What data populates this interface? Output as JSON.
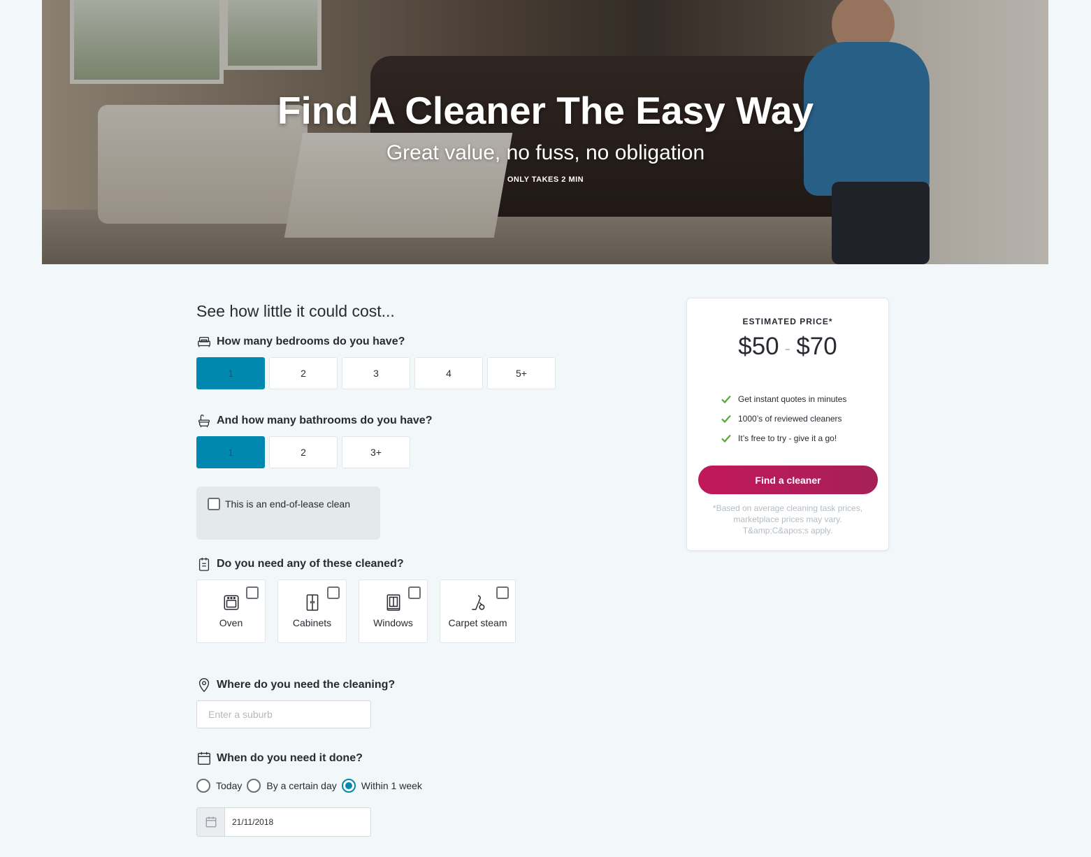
{
  "hero": {
    "title": "Find A Cleaner The Easy Way",
    "subtitle": "Great value, no fuss, no obligation",
    "small": "ONLY TAKES 2 MIN"
  },
  "form": {
    "heading": "See how little it could cost...",
    "bedrooms": {
      "label": "How many bedrooms do you have?",
      "options": [
        "1",
        "2",
        "3",
        "4",
        "5+"
      ],
      "selected": "1"
    },
    "bathrooms": {
      "label": "And how many bathrooms do you have?",
      "options": [
        "1",
        "2",
        "3+"
      ],
      "selected": "1"
    },
    "end_of_lease": {
      "label": "This is an end-of-lease clean",
      "checked": false
    },
    "extras": {
      "label": "Do you need any of these cleaned?",
      "items": [
        {
          "label": "Oven",
          "icon": "oven-icon",
          "checked": false
        },
        {
          "label": "Cabinets",
          "icon": "cabinets-icon",
          "checked": false
        },
        {
          "label": "Windows",
          "icon": "windows-icon",
          "checked": false
        },
        {
          "label": "Carpet steam",
          "icon": "vacuum-icon",
          "checked": false
        }
      ]
    },
    "location": {
      "label": "Where do you need the cleaning?",
      "placeholder": "Enter a suburb",
      "value": ""
    },
    "timing": {
      "label": "When do you need it done?",
      "options": [
        "Today",
        "By a certain day",
        "Within 1 week"
      ],
      "selected": "Within 1 week",
      "date": "21/11/2018"
    }
  },
  "estimate": {
    "title": "ESTIMATED PRICE*",
    "low": "$50",
    "separator": "-",
    "high": "$70",
    "benefits": [
      "Get instant quotes in minutes",
      "1000’s of reviewed cleaners",
      "It’s free to try - give it a go!"
    ],
    "button": "Find a cleaner",
    "fine_print": "*Based on average cleaning task prices, marketplace prices may vary. T&amp;C&apos;s apply."
  },
  "colors": {
    "accent": "#0088b1",
    "cta": "#b81e5c",
    "check": "#5aa63a",
    "background": "#f2f7f9"
  }
}
